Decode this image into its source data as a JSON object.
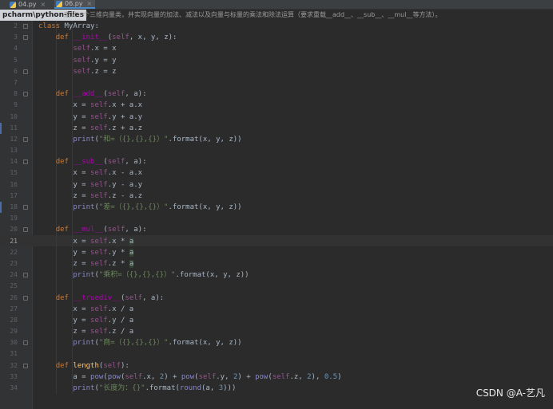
{
  "tabs": [
    {
      "label": "04.py",
      "active": false
    },
    {
      "label": "06.py",
      "active": true
    }
  ],
  "path_label": "pcharm\\python-files",
  "task_description": "定义一个三维向量类，并实现向量的加法、减法以及向量与标量的乘法和除法运算（要求重载__add__、__sub__、__mul__等方法）。",
  "current_line": 21,
  "watermark": "CSDN @A-艺凡",
  "colors": {
    "background": "#2b2b2b",
    "keyword": "#cc7832",
    "self": "#94558d",
    "string": "#6a8759",
    "number": "#6897bb",
    "function": "#ffc66d",
    "dunder": "#b200b2"
  },
  "code_lines": [
    {
      "n": "2",
      "html": "<span class='kw'>class</span> MyArray:"
    },
    {
      "n": "3",
      "html": "    <span class='kw'>def</span> <span class='dunder'>__init__</span>(<span class='self'>self</span>, x, y, z):"
    },
    {
      "n": "4",
      "html": "        <span class='self'>self</span>.x = x"
    },
    {
      "n": "5",
      "html": "        <span class='self'>self</span>.y = y"
    },
    {
      "n": "6",
      "html": "        <span class='self'>self</span>.z = z"
    },
    {
      "n": "7",
      "html": ""
    },
    {
      "n": "8",
      "html": "    <span class='kw'>def</span> <span class='dunder'>__add__</span>(<span class='self'>self</span>, a):"
    },
    {
      "n": "9",
      "html": "        x = <span class='self'>self</span>.x + a.x"
    },
    {
      "n": "10",
      "html": "        y = <span class='self'>self</span>.y + a.y"
    },
    {
      "n": "11",
      "html": "        z = <span class='self'>self</span>.z + a.z"
    },
    {
      "n": "12",
      "html": "        <span class='builtin'>print</span>(<span class='str'>\"和=（{},{},{}）\"</span>.format(x, y, z))"
    },
    {
      "n": "13",
      "html": ""
    },
    {
      "n": "14",
      "html": "    <span class='kw'>def</span> <span class='dunder'>__sub__</span>(<span class='self'>self</span>, a):"
    },
    {
      "n": "15",
      "html": "        x = <span class='self'>self</span>.x - a.x"
    },
    {
      "n": "16",
      "html": "        y = <span class='self'>self</span>.y - a.y"
    },
    {
      "n": "17",
      "html": "        z = <span class='self'>self</span>.z - a.z"
    },
    {
      "n": "18",
      "html": "        <span class='builtin'>print</span>(<span class='str'>\"差=（{},{},{}）\"</span>.format(x, y, z))"
    },
    {
      "n": "19",
      "html": ""
    },
    {
      "n": "20",
      "html": "    <span class='kw'>def</span> <span class='dunder'>__mul__</span>(<span class='self'>self</span>, a):"
    },
    {
      "n": "21",
      "html": "        x = <span class='self'>self</span>.x * <span class='param-hl'>a</span>"
    },
    {
      "n": "22",
      "html": "        y = <span class='self'>self</span>.y * <span class='param-hl'>a</span>"
    },
    {
      "n": "23",
      "html": "        z = <span class='self'>self</span>.z * <span class='param-hl'>a</span>"
    },
    {
      "n": "24",
      "html": "        <span class='builtin'>print</span>(<span class='str'>\"乘积=（{},{},{}）\"</span>.format(x, y, z))"
    },
    {
      "n": "25",
      "html": ""
    },
    {
      "n": "26",
      "html": "    <span class='kw'>def</span> <span class='dunder'>__truediv__</span>(<span class='self'>self</span>, a):"
    },
    {
      "n": "27",
      "html": "        x = <span class='self'>self</span>.x / a"
    },
    {
      "n": "28",
      "html": "        y = <span class='self'>self</span>.y / a"
    },
    {
      "n": "29",
      "html": "        z = <span class='self'>self</span>.z / a"
    },
    {
      "n": "30",
      "html": "        <span class='builtin'>print</span>(<span class='str'>\"商=（{},{},{}）\"</span>.format(x, y, z))"
    },
    {
      "n": "31",
      "html": ""
    },
    {
      "n": "32",
      "html": "    <span class='kw'>def</span> <span class='fn'>length</span>(<span class='self'>self</span>):"
    },
    {
      "n": "33",
      "html": "        a = <span class='builtin'>pow</span>(<span class='builtin'>pow</span>(<span class='self'>self</span>.x, <span class='num'>2</span>) + <span class='builtin'>pow</span>(<span class='self'>self</span>.y, <span class='num'>2</span>) + <span class='builtin'>pow</span>(<span class='self'>self</span>.z, <span class='num'>2</span>), <span class='num'>0.5</span>)"
    },
    {
      "n": "34",
      "html": "        <span class='builtin'>print</span>(<span class='str'>\"长度为：{}\"</span>.format(<span class='builtin'>round</span>(a, <span class='num'>3</span>)))"
    }
  ]
}
